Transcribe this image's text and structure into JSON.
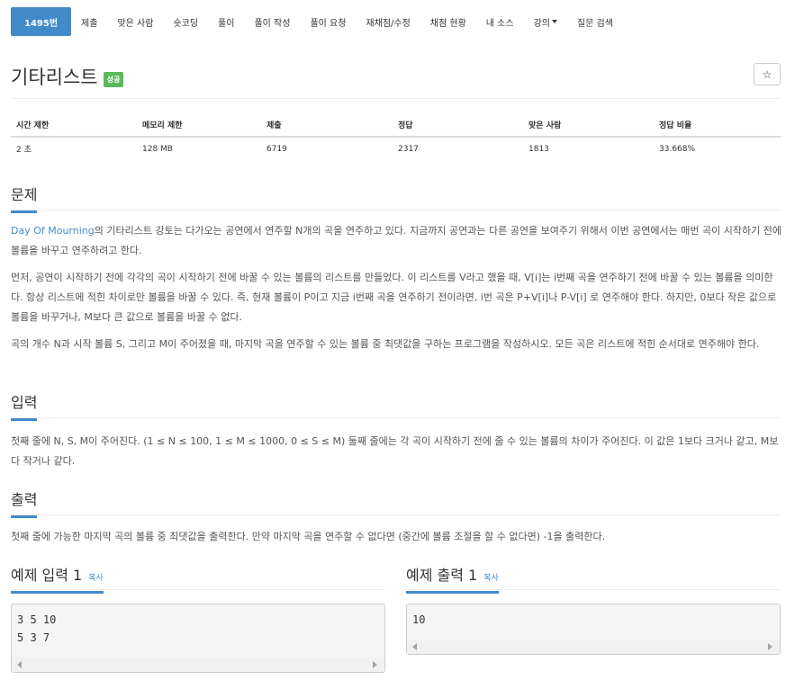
{
  "nav": {
    "items": [
      "1495번",
      "제출",
      "맞은 사람",
      "숏코딩",
      "풀이",
      "풀이 작성",
      "풀이 요청",
      "재채점/수정",
      "채점 현황",
      "내 소스",
      "강의",
      "질문 검색"
    ]
  },
  "header": {
    "title": "기타리스트",
    "badge": "성공",
    "star": "☆"
  },
  "info_table": {
    "headers": [
      "시간 제한",
      "메모리 제한",
      "제출",
      "정답",
      "맞은 사람",
      "정답 비율"
    ],
    "values": [
      "2 초",
      "128 MB",
      "6719",
      "2317",
      "1813",
      "33.668%"
    ]
  },
  "problem": {
    "heading": "문제",
    "link_text": "Day Of Mourning",
    "p1_rest": "의 기타리스트 강토는 다가오는 공연에서 연주할 N개의 곡을 연주하고 있다. 지금까지 공연과는 다른 공연을 보여주기 위해서 이번 공연에서는 매번 곡이 시작하기 전에 볼륨을 바꾸고 연주하려고 한다.",
    "p2": "먼저, 공연이 시작하기 전에 각각의 곡이 시작하기 전에 바꿀 수 있는 볼륨의 리스트를 만들었다. 이 리스트를 V라고 했을 때, V[i]는 i번째 곡을 연주하기 전에 바꿀 수 있는 볼륨을 의미한다. 항상 리스트에 적힌 차이로만 볼륨을 바꿀 수 있다. 즉, 현재 볼륨이 P이고 지금 i번째 곡을 연주하기 전이라면, i번 곡은 P+V[i]나 P-V[i] 로 연주해야 한다. 하지만, 0보다 작은 값으로 볼륨을 바꾸거나, M보다 큰 값으로 볼륨을 바꿀 수 없다.",
    "p3": "곡의 개수 N과 시작 볼륨 S, 그리고 M이 주어졌을 때, 마지막 곡을 연주할 수 있는 볼륨 중 최댓값을 구하는 프로그램을 작성하시오. 모든 곡은 리스트에 적힌 순서대로 연주해야 한다."
  },
  "input": {
    "heading": "입력",
    "text": "첫째 줄에 N, S, M이 주어진다. (1 ≤ N ≤ 100, 1 ≤ M ≤ 1000, 0 ≤ S ≤ M) 둘째 줄에는 각 곡이 시작하기 전에 줄 수 있는 볼륨의 차이가 주어진다. 이 값은 1보다 크거나 같고, M보다 작거나 같다."
  },
  "output": {
    "heading": "출력",
    "text": "첫째 줄에 가능한 마지막 곡의 볼륨 중 최댓값을 출력한다. 만약 마지막 곡을 연주할 수 없다면 (중간에 볼륨 조절을 할 수 없다면) -1을 출력한다."
  },
  "samples": {
    "input_heading": "예제 입력 1",
    "output_heading": "예제 출력 1",
    "copy_label": "복사",
    "input_text": "3 5 10\n5 3 7",
    "output_text": "10"
  }
}
